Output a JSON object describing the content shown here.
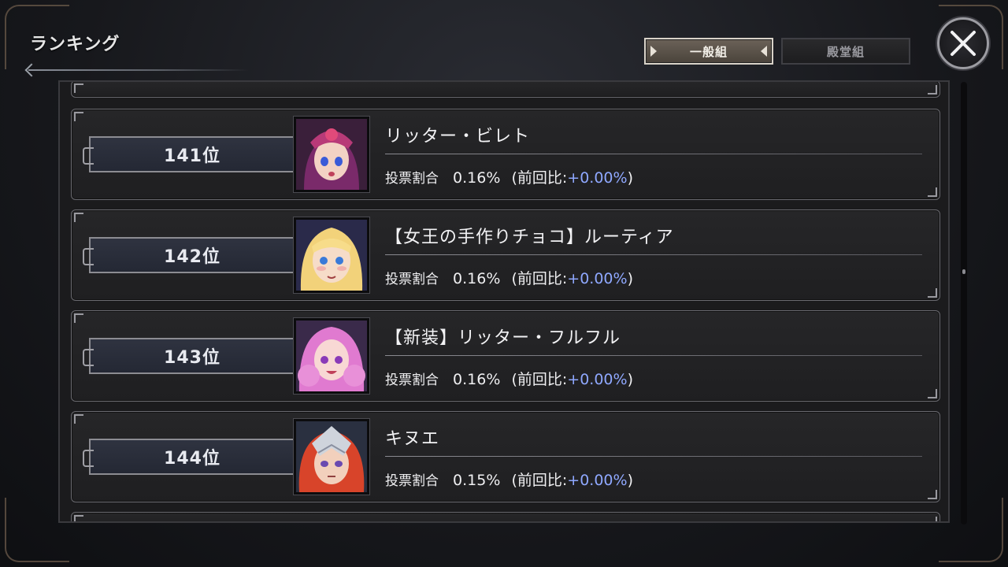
{
  "window": {
    "title": "ランキング"
  },
  "tabs": [
    {
      "label": "一般組",
      "active": true
    },
    {
      "label": "殿堂組",
      "active": false
    }
  ],
  "close_icon": "close-x-icon",
  "stat_label": "投票割合",
  "delta_prefix": "(前回比:",
  "delta_suffix": ")",
  "rankings": [
    {
      "rank": "141位",
      "name": "リッター・ビレト",
      "percent": "0.16%",
      "delta": "+0.00%"
    },
    {
      "rank": "142位",
      "name": "【女王の手作りチョコ】ルーティア",
      "percent": "0.16%",
      "delta": "+0.00%"
    },
    {
      "rank": "143位",
      "name": "【新装】リッター・フルフル",
      "percent": "0.16%",
      "delta": "+0.00%"
    },
    {
      "rank": "144位",
      "name": "キヌエ",
      "percent": "0.15%",
      "delta": "+0.00%"
    }
  ],
  "colors": {
    "accent_delta": "#8fa8ff",
    "tab_active_border": "#d8d2c8"
  }
}
